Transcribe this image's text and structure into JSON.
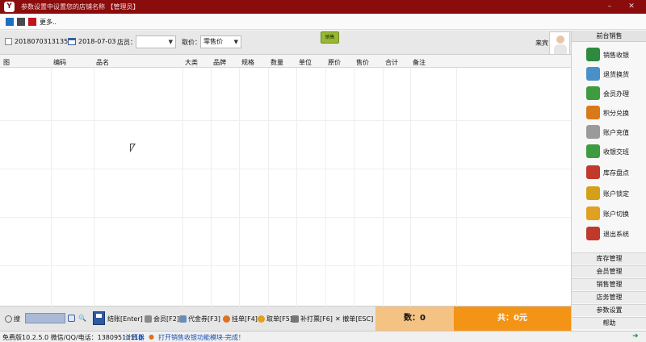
{
  "titlebar": {
    "title": "参数设置中设置您的店铺名称 【管理员】",
    "logo_text": "Y",
    "minimize": "–",
    "close": "✕"
  },
  "theme": {
    "swatches": [
      "#1e6fc0",
      "#4a4a4a",
      "#c0141e"
    ],
    "more_label": "更多.."
  },
  "filter": {
    "order_no": "20180703131350",
    "date": "2018-07-03",
    "clerk_label": "店员：",
    "clerk_value": "",
    "price_label": "取价：",
    "price_value": "零售价",
    "tag_label": "销售",
    "guest_label": "来宾"
  },
  "grid": {
    "columns": [
      "图",
      "编码",
      "品名",
      "大类",
      "品牌",
      "规格",
      "数量",
      "单位",
      "原价",
      "售价",
      "合计",
      "备注"
    ]
  },
  "bottom": {
    "search_label": "搜",
    "search_value": "",
    "settle_label": "结账[Enter]",
    "member_label": "会员[F2]",
    "voucher_label": "代金券[F3]",
    "hold_label": "挂单[F4]",
    "retrieve_label": "取单[F5]",
    "reprint_label": "补打票[F6]",
    "cancel_label": "撤单[ESC]",
    "count_text": "数：0",
    "total_text": "共：0元"
  },
  "sidebar": {
    "header": "前台销售",
    "items": [
      "销售收银",
      "退货换货",
      "会员办理",
      "积分兑换",
      "账户充值",
      "收银交班",
      "库存盘点",
      "账户锁定",
      "账户切换",
      "退出系统"
    ],
    "item_colors": [
      "#2d8a3e",
      "#4a90c8",
      "#3f9b3f",
      "#d97a1a",
      "#9a9a9a",
      "#3f9b3f",
      "#c0392b",
      "#d4a017",
      "#e0a020",
      "#c0392b"
    ],
    "menus": [
      "库存管理",
      "会员管理",
      "销售管理",
      "店务管理",
      "参数设置",
      "帮助"
    ]
  },
  "statusbar": {
    "version": "免费版10.2.5.0 微信/QQ/电话：13809511110",
    "calculator": "计算器",
    "message": "打开销售收银功能模块-完成！"
  }
}
